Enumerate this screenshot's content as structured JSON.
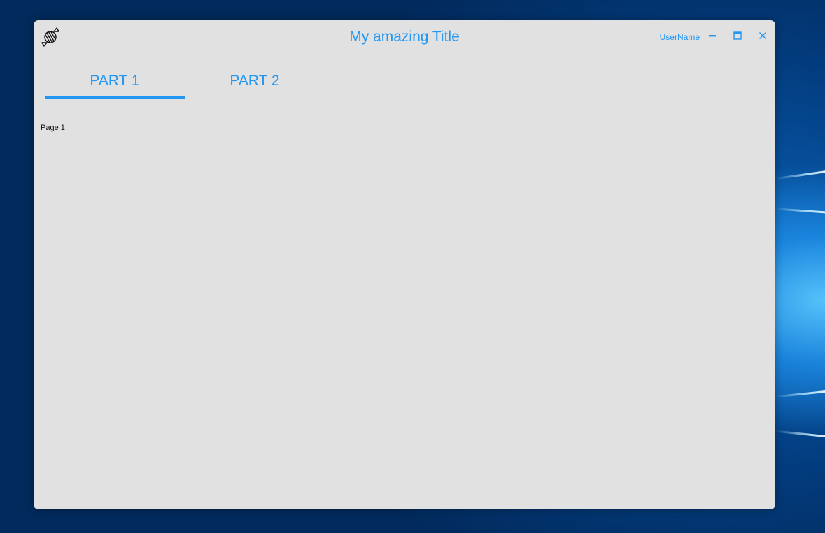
{
  "window": {
    "title": "My amazing Title",
    "username": "UserName",
    "logo_icon": "candy-icon",
    "controls": {
      "minimize_icon": "minimize-icon",
      "maximize_icon": "maximize-icon",
      "close_icon": "close-icon"
    }
  },
  "tabs": [
    {
      "label": "PART 1",
      "selected": true
    },
    {
      "label": "PART 2",
      "selected": false
    }
  ],
  "content": {
    "text": "Page 1"
  },
  "colors": {
    "accent": "#2196f3",
    "window_bg": "#e1e1e1"
  }
}
